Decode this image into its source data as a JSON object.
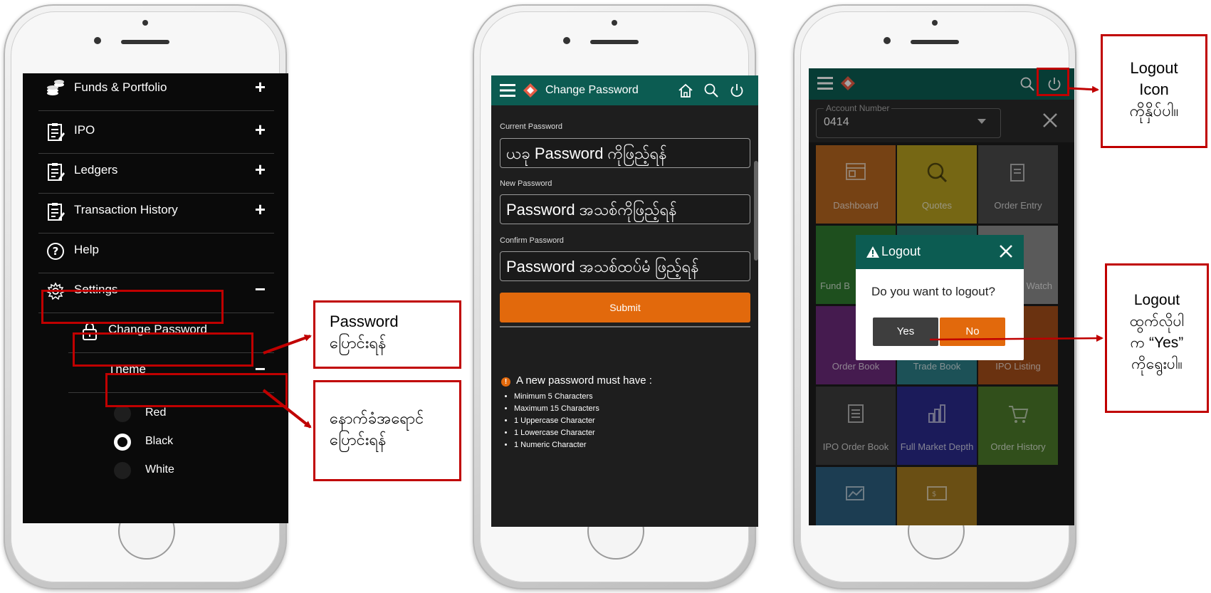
{
  "screen1": {
    "menu": [
      {
        "label": "Funds & Portfolio",
        "toggle": "+",
        "icon": "coins-icon"
      },
      {
        "label": "IPO",
        "toggle": "+",
        "icon": "clipboard-icon"
      },
      {
        "label": "Ledgers",
        "toggle": "+",
        "icon": "clipboard-icon"
      },
      {
        "label": "Transaction History",
        "toggle": "+",
        "icon": "clipboard-icon"
      },
      {
        "label": "Help",
        "toggle": "",
        "icon": "help-icon"
      },
      {
        "label": "Settings",
        "toggle": "−",
        "icon": "gear-icon"
      }
    ],
    "change_password": "Change Password",
    "theme": {
      "label": "Theme",
      "toggle": "−",
      "options": [
        "Red",
        "Black",
        "White"
      ],
      "selected": "Black"
    }
  },
  "screen2": {
    "title": "Change Password",
    "current_label": "Current Password",
    "current_value": "ယခု Password ကိုဖြည့်ရန်",
    "new_label": "New Password",
    "new_value": "Password အသစ်ကိုဖြည့်ရန်",
    "confirm_label": "Confirm Password",
    "confirm_value": "Password အသစ်ထပ်မံ ဖြည့်ရန်",
    "submit": "Submit",
    "rules_title": "A new password must have :",
    "rules": [
      "Minimum 5 Characters",
      "Maximum 15 Characters",
      "1 Uppercase Character",
      "1 Lowercase Character",
      "1 Numeric Character"
    ]
  },
  "screen3": {
    "account_label": "Account Number",
    "account_value": "0414",
    "tiles": [
      {
        "label": "Dashboard",
        "color": "#b5661f"
      },
      {
        "label": "Quotes",
        "color": "#b59f1f"
      },
      {
        "label": "Order Entry",
        "color": "#4a4a4a"
      },
      {
        "label": "Fund B",
        "color": "#2e7a2e"
      },
      {
        "label": "",
        "color": "#2b7d77"
      },
      {
        "label": "Watch",
        "color": "#8a8a8a"
      },
      {
        "label": "Order Book",
        "color": "#6b2a7a"
      },
      {
        "label": "Trade Book",
        "color": "#2b7d86"
      },
      {
        "label": "IPO Listing",
        "color": "#a34d1a"
      },
      {
        "label": "IPO Order Book",
        "color": "#3d3d3d"
      },
      {
        "label": "Full Market Depth",
        "color": "#2a2a8a"
      },
      {
        "label": "Order History",
        "color": "#4c7a2a"
      },
      {
        "label": "",
        "color": "#2c5f7f"
      },
      {
        "label": "",
        "color": "#a37a1f"
      }
    ],
    "dialog": {
      "title": "Logout",
      "message": "Do you want to logout?",
      "yes": "Yes",
      "no": "No"
    }
  },
  "callouts": {
    "password": [
      "Password",
      "ပြောင်းရန်"
    ],
    "theme": [
      "နောက်ခံအရောင်",
      "ပြောင်းရန်"
    ],
    "logout_icon": [
      "Logout",
      "Icon",
      "ကိုနှိပ်ပါ။"
    ],
    "logout_yes": [
      "Logout",
      "ထွက်လိုပါ",
      "က “Yes”",
      "ကိုရွေးပါ။"
    ]
  },
  "colors": {
    "teal": "#0c5c52",
    "orange": "#e2690c",
    "callout_red": "#c00000"
  }
}
